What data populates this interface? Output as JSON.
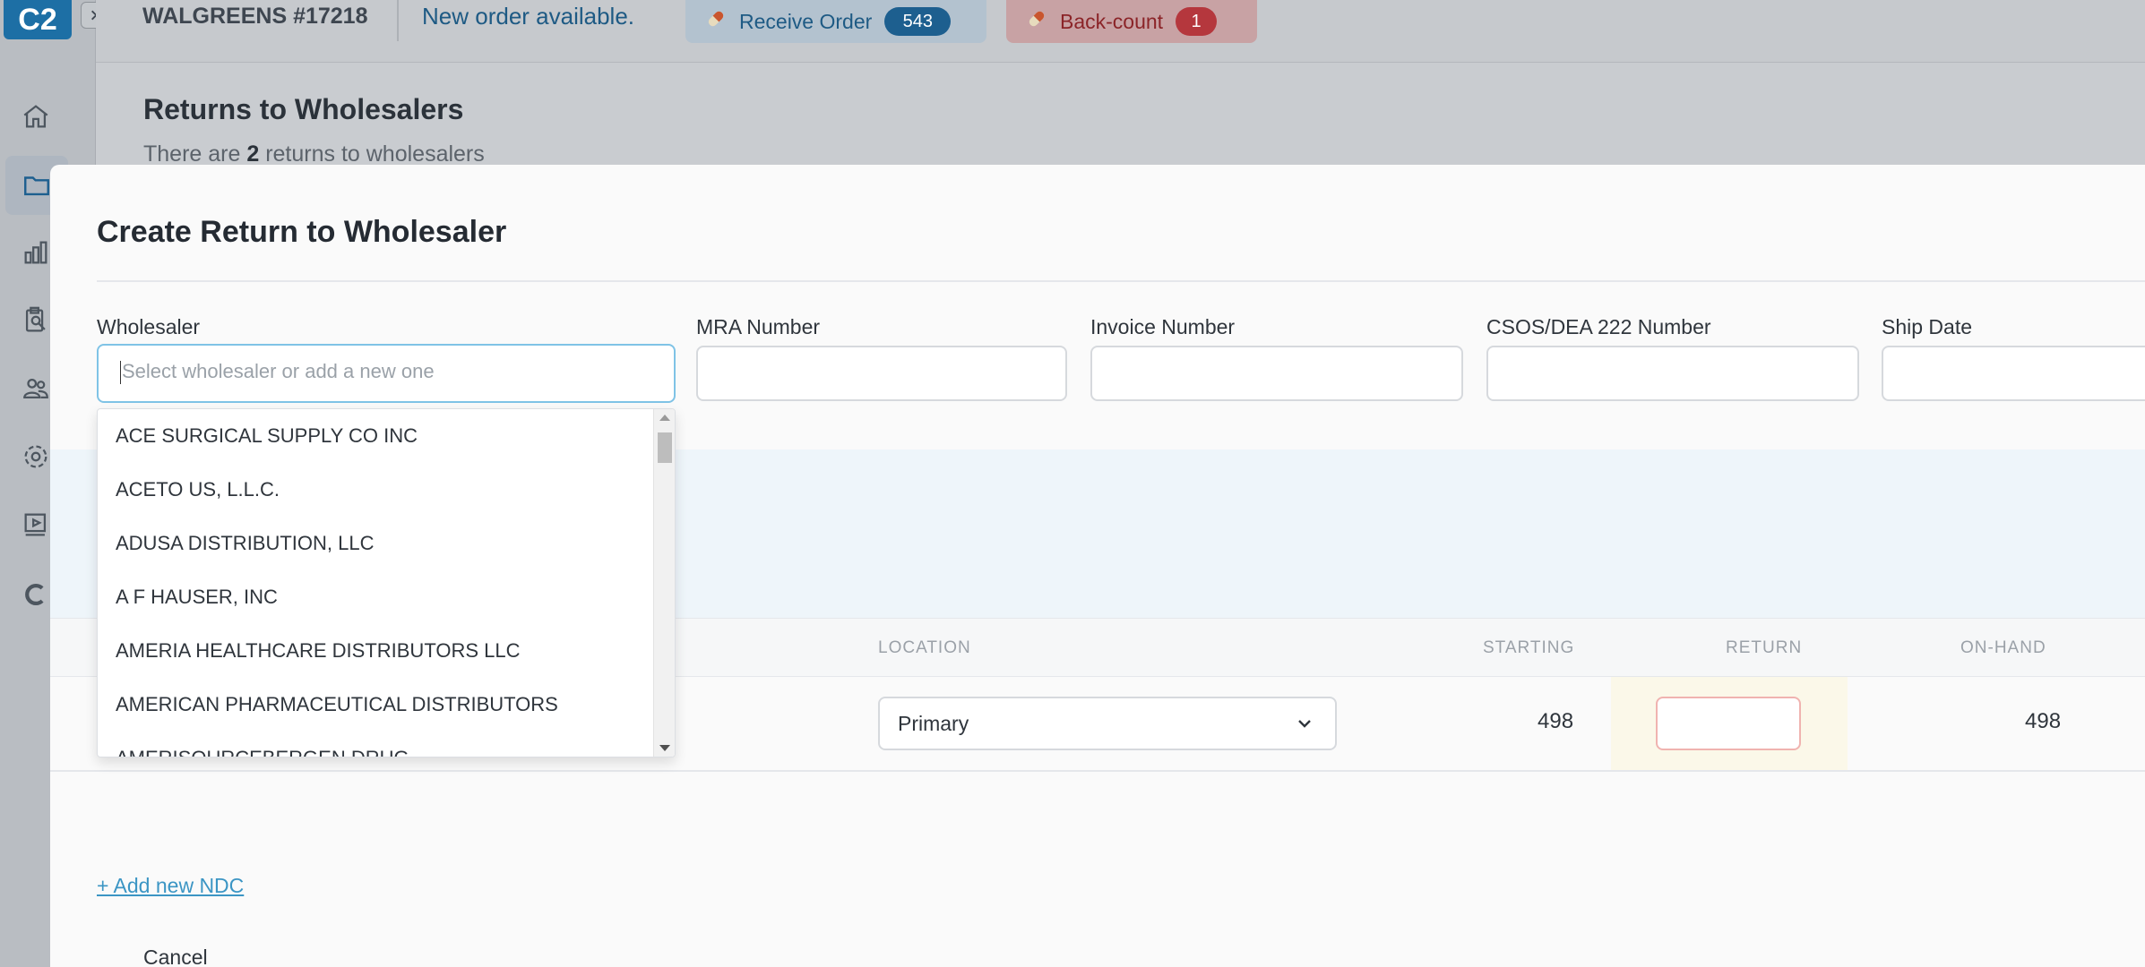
{
  "app": {
    "logo": "C2",
    "store_name": "WALGREENS #17218",
    "notice": "New order available.",
    "receive_order": {
      "label": "Receive Order",
      "count": "543"
    },
    "back_count": {
      "label": "Back-count",
      "count": "1"
    }
  },
  "nav": [
    "home-icon",
    "folder-icon",
    "chart-icon",
    "clipboard-search-icon",
    "users-icon",
    "settings-icon",
    "video-icon",
    "c-logo-icon"
  ],
  "page": {
    "title": "Returns to Wholesalers",
    "subtitle_prefix": "There are ",
    "subtitle_count": "2",
    "subtitle_suffix": " returns to wholesalers"
  },
  "modal": {
    "title": "Create Return to Wholesaler",
    "fields": {
      "wholesaler": {
        "label": "Wholesaler",
        "placeholder": "Select wholesaler or add a new one"
      },
      "mra": {
        "label": "MRA Number",
        "value": ""
      },
      "invoice": {
        "label": "Invoice Number",
        "value": ""
      },
      "csos": {
        "label": "CSOS/DEA 222 Number",
        "value": ""
      },
      "ship_date": {
        "label": "Ship Date",
        "value": ""
      }
    },
    "dropdown_options": [
      "ACE SURGICAL SUPPLY CO INC",
      "ACETO US, L.L.C.",
      "ADUSA DISTRIBUTION, LLC",
      "A F HAUSER, INC",
      "AMERIA HEALTHCARE DISTRIBUTORS LLC",
      "AMERICAN PHARMACEUTICAL DISTRIBUTORS",
      "AMERISOURCEBERGEN DRUG"
    ],
    "table": {
      "headers": {
        "location": "LOCATION",
        "starting": "STARTING",
        "return": "RETURN",
        "on_hand": "ON-HAND"
      },
      "row": {
        "location": "Primary",
        "starting": "498",
        "return": "",
        "on_hand": "498"
      }
    },
    "add_ndc": "+ Add new NDC",
    "cancel": "Cancel"
  }
}
